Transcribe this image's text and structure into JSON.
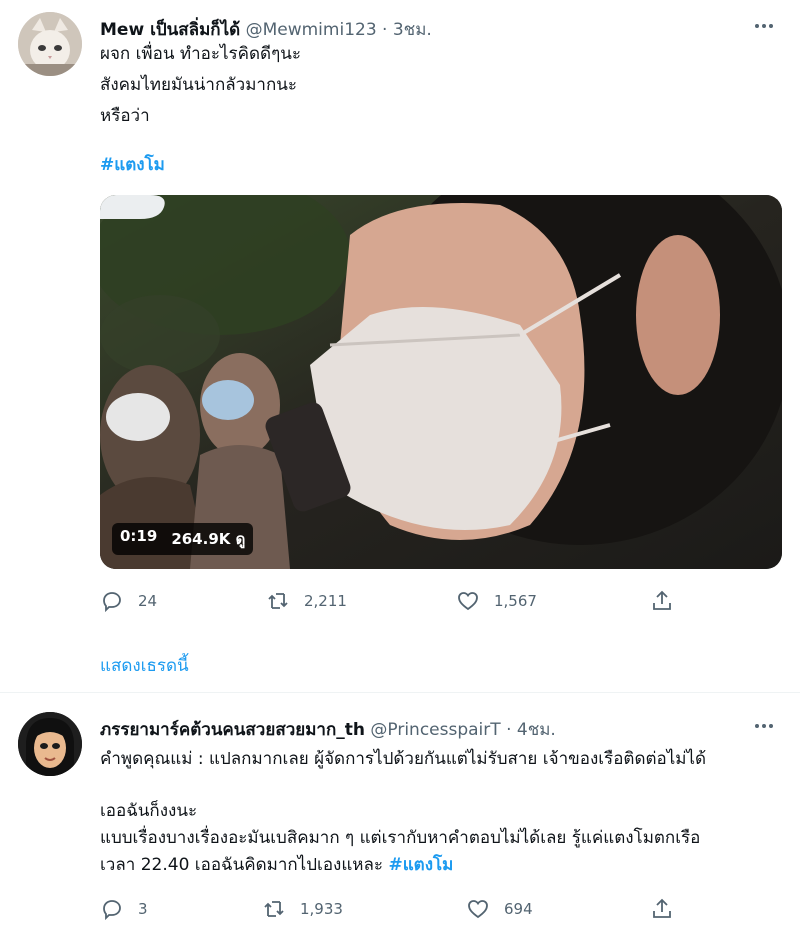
{
  "tweet1": {
    "display_name": "Mew เป็นสลิ่มก็ได้",
    "handle": "@Mewmimi123",
    "separator": "·",
    "time": "3ชม.",
    "lines": [
      "ผจก เพื่อน ทำอะไรคิดดีๆนะ",
      "สังคมไทยมันน่ากลัวมากนะ",
      "หรือว่า"
    ],
    "hashtag": "#แตงโม",
    "video": {
      "duration": "0:19",
      "views": "264.9K ดู"
    },
    "replies": "24",
    "retweets": "2,211",
    "likes": "1,567",
    "show_thread": "แสดงเธรดนี้"
  },
  "tweet2": {
    "display_name": "ภรรยามาร์คต้วนคนสวยสวยมาก_th",
    "handle": "@PrincesspairT",
    "separator": "·",
    "time": "4ชม.",
    "line1": "คำพูดคุณแม่ : แปลกมากเลย ผู้จัดการไปด้วยกันแต่ไม่รับสาย เจ้าของเรือติดต่อไม่ได้",
    "line2": "เออฉันก็งงนะ",
    "line3": "แบบเรื่องบางเรื่องอะมันเบสิคมาก ๆ แต่เรากับหาคำตอบไม่ได้เลย รู้แค่แตงโมตกเรือ",
    "line4": "เวลา 22.40 เออฉันคิดมากไปเองแหละ",
    "hashtag": "#แตงโม",
    "replies": "3",
    "retweets": "1,933",
    "likes": "694"
  },
  "colors": {
    "link": "#1d9bf0",
    "secondary": "#536471",
    "text": "#0f1419"
  }
}
